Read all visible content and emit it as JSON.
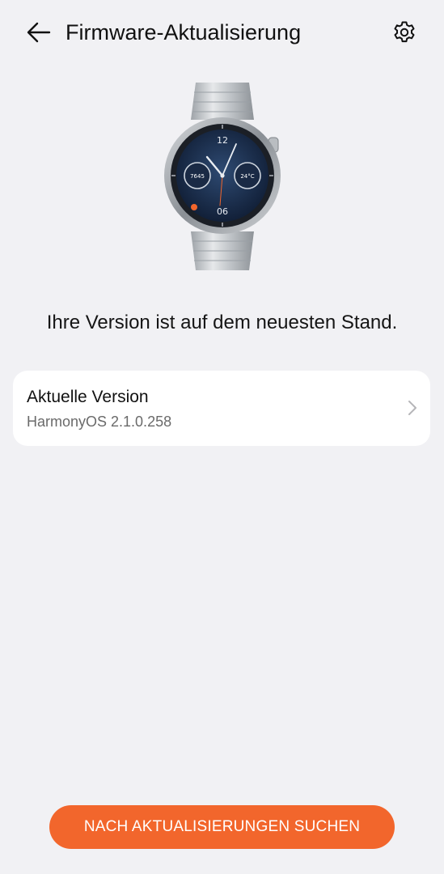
{
  "header": {
    "title": "Firmware-Aktualisierung",
    "back_icon": "arrow-left-icon",
    "settings_icon": "gear-icon"
  },
  "device": {
    "image": "smartwatch-image",
    "face": {
      "hour_top": "12",
      "hour_bottom": "06",
      "left_dial": "7645",
      "right_dial": "24°C"
    }
  },
  "status": {
    "message": "Ihre Version ist auf dem neuesten Stand."
  },
  "version_card": {
    "label": "Aktuelle Version",
    "value": "HarmonyOS 2.1.0.258",
    "chevron_icon": "chevron-right-icon"
  },
  "actions": {
    "check_updates_label": "NACH AKTUALISIERUNGEN SUCHEN"
  },
  "colors": {
    "background": "#f1f1f4",
    "accent": "#f2662c",
    "card": "#ffffff",
    "secondary_text": "#6a6a6a"
  }
}
